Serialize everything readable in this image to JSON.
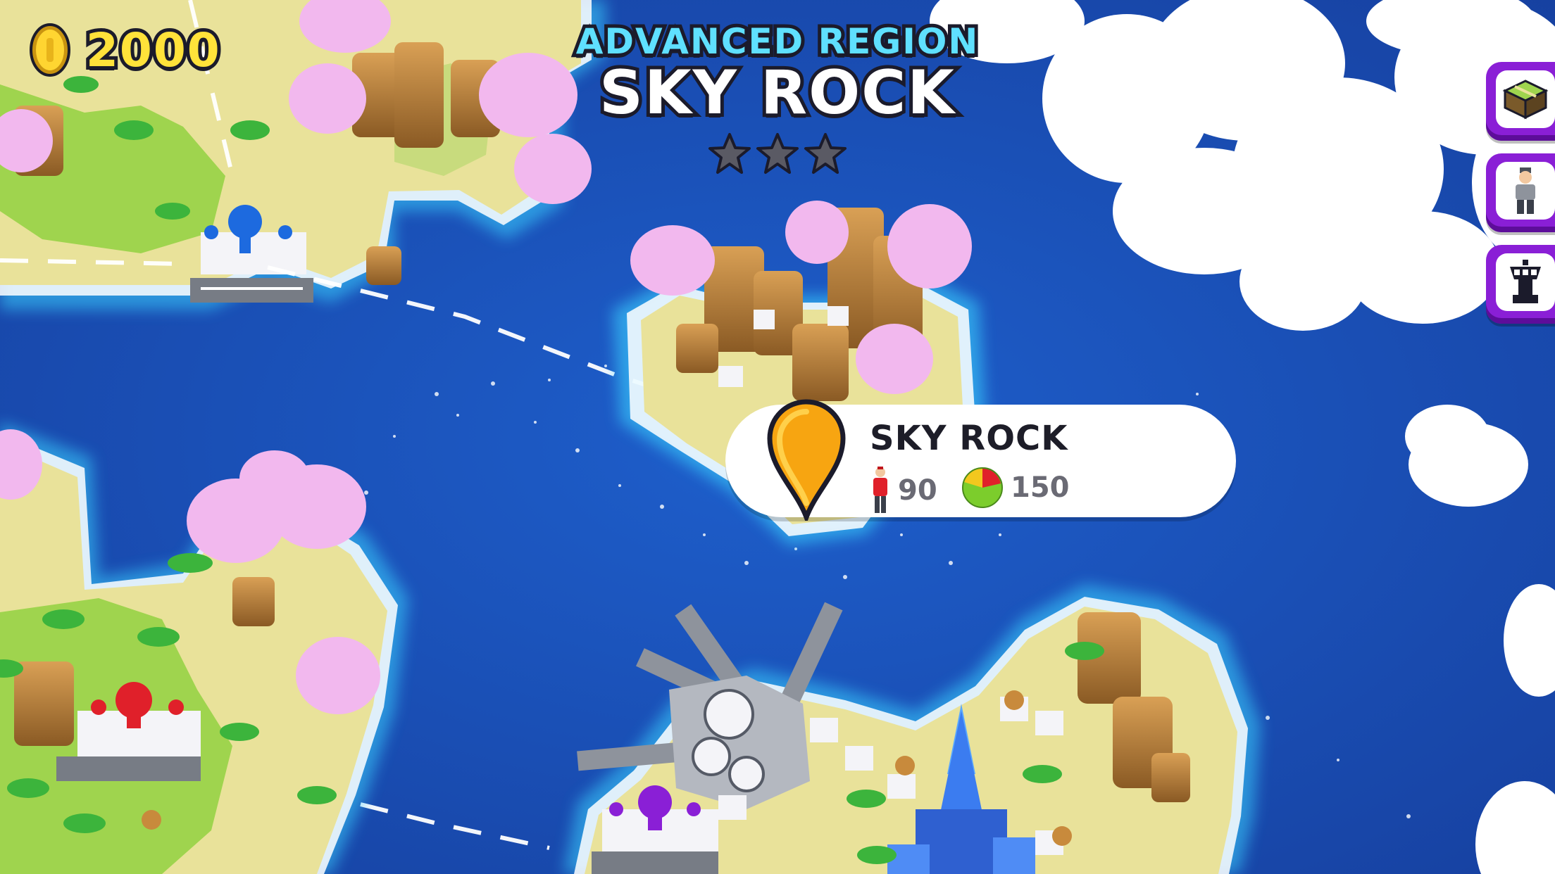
{
  "hud": {
    "coins": "2000",
    "icons": {
      "coin": "coin-icon"
    }
  },
  "region": {
    "tier": "ADVANCED REGION",
    "name": "SKY ROCK",
    "stars_total": 3,
    "stars_earned": 0
  },
  "selected_island": {
    "name": "SKY ROCK",
    "population": "90",
    "resources": "150",
    "icons": {
      "pin": "map-pin-icon",
      "population": "person-icon",
      "resources": "pie-chart-icon"
    }
  },
  "side_menu": [
    {
      "name": "map-tile-button",
      "icon": "map-tile-icon"
    },
    {
      "name": "passenger-button",
      "icon": "passenger-icon"
    },
    {
      "name": "control-tower-button",
      "icon": "control-tower-icon"
    }
  ],
  "colors": {
    "ocean": "#1a4fb4",
    "shallow": "#38c8ff",
    "sand": "#e9e29a",
    "grass": "#9fd44e",
    "rock": "#c88a3c",
    "blossom": "#f2b8ee",
    "accent_purple": "#8a1fd6",
    "coin_yellow": "#ffe23a",
    "tier_cyan": "#5fe0ff"
  }
}
